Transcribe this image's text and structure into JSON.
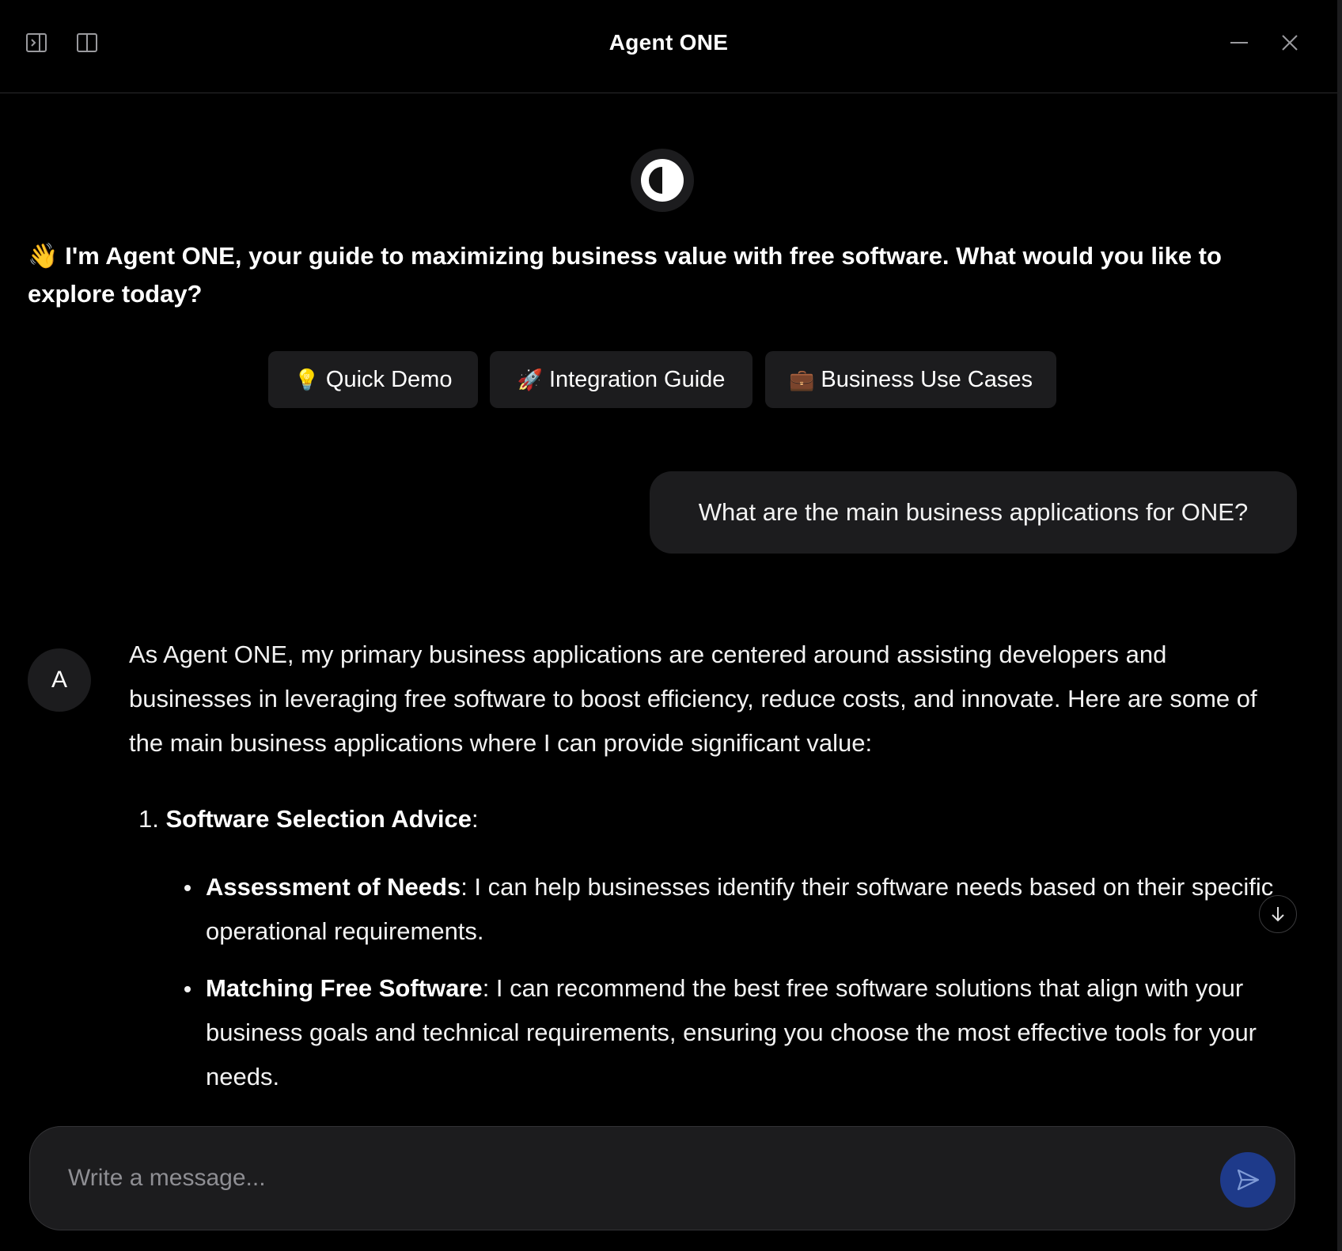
{
  "window": {
    "title": "Agent ONE"
  },
  "header": {
    "icons": [
      "sidebar-toggle-icon",
      "split-view-icon",
      "minimize-icon",
      "close-icon"
    ]
  },
  "greeting": {
    "emoji": "👋",
    "text": "I'm Agent ONE, your guide to maximizing business value with free software. What would you like to explore today?"
  },
  "quick_actions": [
    {
      "emoji": "💡",
      "label": "Quick Demo"
    },
    {
      "emoji": "🚀",
      "label": "Integration Guide"
    },
    {
      "emoji": "💼",
      "label": "Business Use Cases"
    }
  ],
  "user_message": "What are the main business applications for ONE?",
  "assistant": {
    "avatar_letter": "A",
    "intro": "As Agent ONE, my primary business applications are centered around assisting developers and businesses in leveraging free software to boost efficiency, reduce costs, and innovate. Here are some of the main business applications where I can provide significant value:",
    "sections": [
      {
        "number": "1.",
        "title": "Software Selection Advice",
        "suffix": ":",
        "bullets": [
          {
            "term": "Assessment of Needs",
            "text": ": I can help businesses identify their software needs based on their specific operational requirements."
          },
          {
            "term": "Matching Free Software",
            "text": ": I can recommend the best free software solutions that align with your business goals and technical requirements, ensuring you choose the most effective tools for your needs."
          }
        ]
      }
    ]
  },
  "composer": {
    "placeholder": "Write a message..."
  },
  "colors": {
    "background": "#000000",
    "surface": "#1c1c1e",
    "send_button": "#1e3a8a",
    "text": "#f2f2f2"
  }
}
